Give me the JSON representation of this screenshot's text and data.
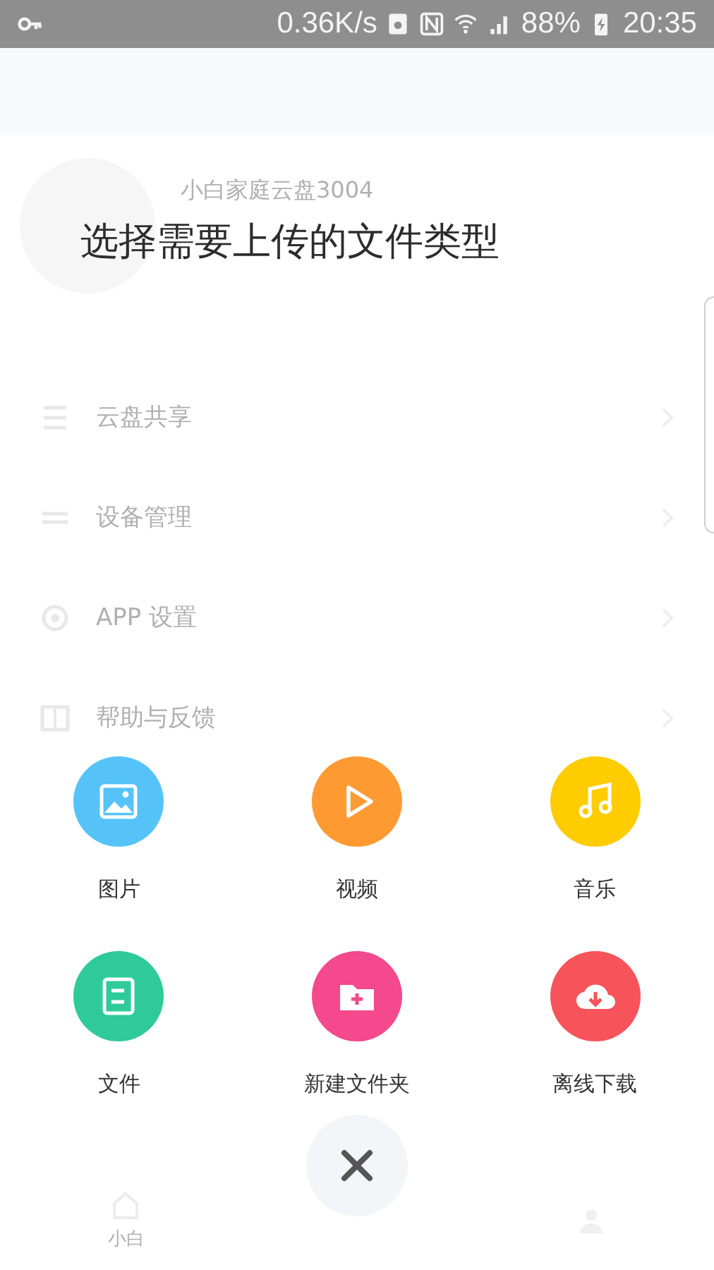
{
  "status_bar": {
    "network_speed": "0.36K/s",
    "battery": "88%",
    "time": "20:35"
  },
  "background": {
    "user_name": "小白家庭云盘3004",
    "menu": [
      {
        "label": "云盘共享",
        "kind": "list"
      },
      {
        "label": "设备管理",
        "kind": "device"
      },
      {
        "label": "APP 设置",
        "kind": "settings"
      },
      {
        "label": "帮助与反馈",
        "kind": "help"
      }
    ],
    "tab_label": "小白"
  },
  "dialog": {
    "title": "选择需要上传的文件类型",
    "options": [
      {
        "label": "图片",
        "kind": "image",
        "color": "#56c3f8"
      },
      {
        "label": "视频",
        "kind": "video",
        "color": "#ff9a33"
      },
      {
        "label": "音乐",
        "kind": "music",
        "color": "#ffcc00"
      },
      {
        "label": "文件",
        "kind": "file",
        "color": "#2ecb98"
      },
      {
        "label": "新建文件夹",
        "kind": "folder",
        "color": "#f4498c"
      },
      {
        "label": "离线下载",
        "kind": "download",
        "color": "#f6545a"
      }
    ]
  }
}
